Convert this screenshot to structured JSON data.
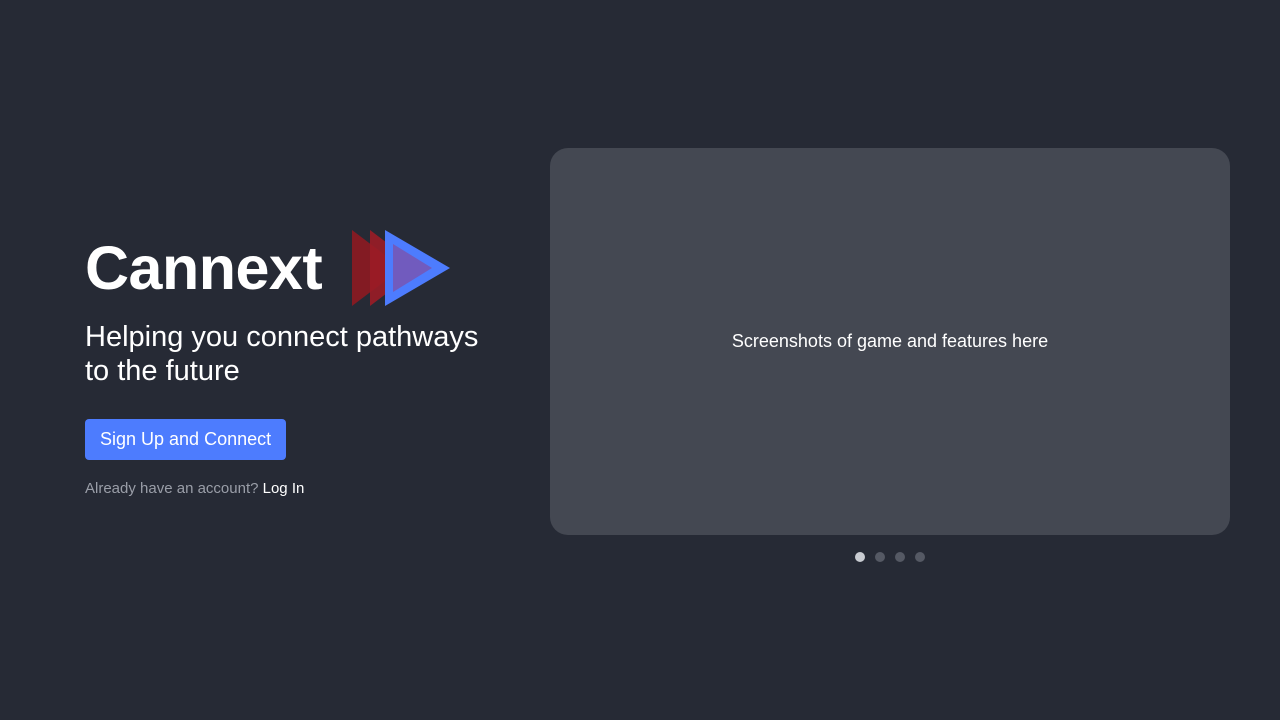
{
  "brand": {
    "name": "Cannext",
    "logo_icon": "double-play-arrow-logo",
    "logo_colors": [
      "#8b1a22",
      "#4d7cfe"
    ]
  },
  "hero": {
    "tagline": "Helping you connect pathways to the future",
    "cta_label": "Sign Up and Connect",
    "login_prompt": "Already have an account?",
    "login_label": "Log In"
  },
  "carousel": {
    "placeholder": "Screenshots of game and features here",
    "slide_count": 4,
    "active_index": 0
  },
  "colors": {
    "background": "#262a35",
    "accent": "#4d7cfe",
    "card": "#444852"
  }
}
